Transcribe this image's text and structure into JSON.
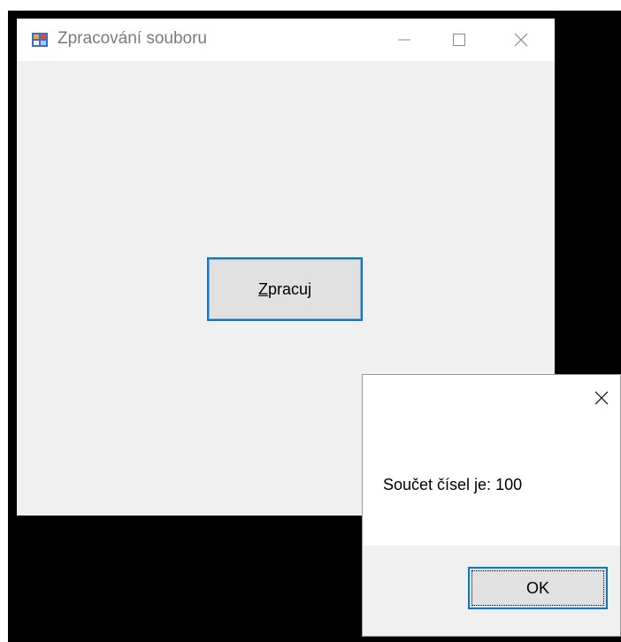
{
  "main_window": {
    "title": "Zpracování souboru",
    "process_button": {
      "mnemonic": "Z",
      "rest": "pracuj"
    }
  },
  "message_box": {
    "text": "Součet čísel je: 100",
    "ok_label": "OK"
  },
  "icons": {
    "app": "app-icon",
    "minimize": "minimize-icon",
    "maximize": "maximize-icon",
    "close": "close-icon"
  },
  "colors": {
    "accent": "#0078d7",
    "window_bg": "#f0f0f0",
    "button_bg": "#e1e1e1",
    "title_text": "#7a7a7a"
  }
}
